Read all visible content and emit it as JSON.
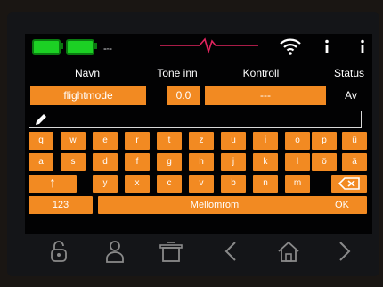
{
  "tabs": [
    "Navn",
    "Tone inn",
    "Kontroll",
    "Status"
  ],
  "fields": {
    "mode": "flightmode",
    "value": "0.0",
    "dash": "---",
    "state": "Av"
  },
  "input": {
    "value": ""
  },
  "keyboard": {
    "row1": [
      "q",
      "w",
      "e",
      "r",
      "t",
      "z",
      "u",
      "i",
      "o",
      "p",
      "ü"
    ],
    "row2": [
      "a",
      "s",
      "d",
      "f",
      "g",
      "h",
      "j",
      "k",
      "l",
      "ö",
      "ä"
    ],
    "row3": [
      "y",
      "x",
      "c",
      "v",
      "b",
      "n",
      "m"
    ],
    "shift_glyph": "↑",
    "numbers_label": "123",
    "space_label": "Mellomrom",
    "ok_label": "OK"
  },
  "colors": {
    "accent": "#f28a22",
    "battery": "#1cd024",
    "pulse": "#e0245e"
  },
  "icons": [
    "battery-icon",
    "connection-icon",
    "pulse-icon",
    "wifi-icon",
    "info-icon",
    "pencil-icon",
    "backspace-icon",
    "unlock-icon",
    "user-icon",
    "pot-icon",
    "back-icon",
    "home-icon",
    "forward-icon"
  ]
}
